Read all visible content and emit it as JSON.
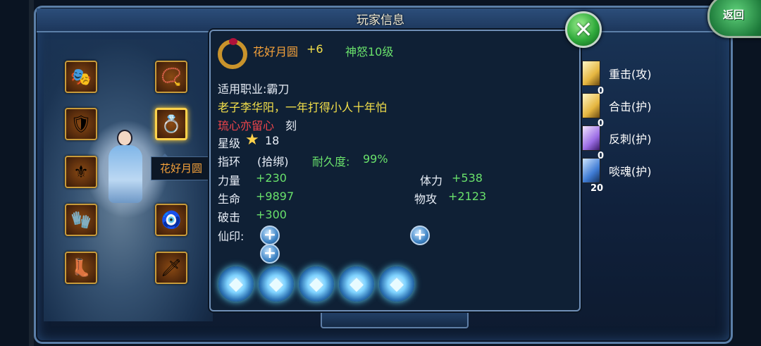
{
  "header": {
    "title": "玩家信息",
    "back_label": "返回"
  },
  "left_panel": {
    "equip_slots": [
      {
        "name": "slot-helmet",
        "icon": "helmet-icon",
        "glyph": "🎭"
      },
      {
        "name": "slot-necklace",
        "icon": "necklace-icon",
        "glyph": "📿"
      },
      {
        "name": "slot-armor",
        "icon": "armor-icon",
        "glyph": "🛡"
      },
      {
        "name": "slot-ring",
        "icon": "ring-icon",
        "glyph": "💍"
      },
      {
        "name": "slot-shoulder",
        "icon": "shoulder-icon",
        "glyph": "⚜"
      },
      {
        "name": "slot-gloves",
        "icon": "gloves-icon",
        "glyph": "🧤"
      },
      {
        "name": "slot-belt",
        "icon": "belt-icon",
        "glyph": "🎗"
      },
      {
        "name": "slot-amulet",
        "icon": "amulet-icon",
        "glyph": "🧿"
      },
      {
        "name": "slot-boots",
        "icon": "boots-icon",
        "glyph": "👢"
      },
      {
        "name": "slot-weapon",
        "icon": "weapon-icon",
        "glyph": "🗡"
      }
    ],
    "selected_tag": "花好月圆"
  },
  "item": {
    "name": "花好月圆",
    "enhance": "+6",
    "rank": "神怒10级",
    "job_label": "适用职业:霸刀",
    "flavor": "老子李华阳，一年打得小人十年怕",
    "engrave_red": "琉心亦留心",
    "engrave_suffix": "刻",
    "star_label": "星级",
    "star_value": "18",
    "type": "指环",
    "bind": "(拾绑)",
    "durability_label": "耐久度:",
    "durability": "99%",
    "stats": [
      {
        "label": "力量",
        "value": "+230"
      },
      {
        "label": "体力",
        "value": "+538"
      },
      {
        "label": "生命",
        "value": "+9897"
      },
      {
        "label": "物攻",
        "value": "+2123"
      },
      {
        "label": "破击",
        "value": "+300"
      }
    ],
    "seal_label": "仙印:"
  },
  "skills": [
    {
      "label": "重击(攻)",
      "num": ""
    },
    {
      "label": "合击(护)",
      "num": "0"
    },
    {
      "label": "反刺(护)",
      "num": "0"
    },
    {
      "label": "啖魂(护)",
      "num": "0"
    }
  ],
  "skill_last_num": "20"
}
